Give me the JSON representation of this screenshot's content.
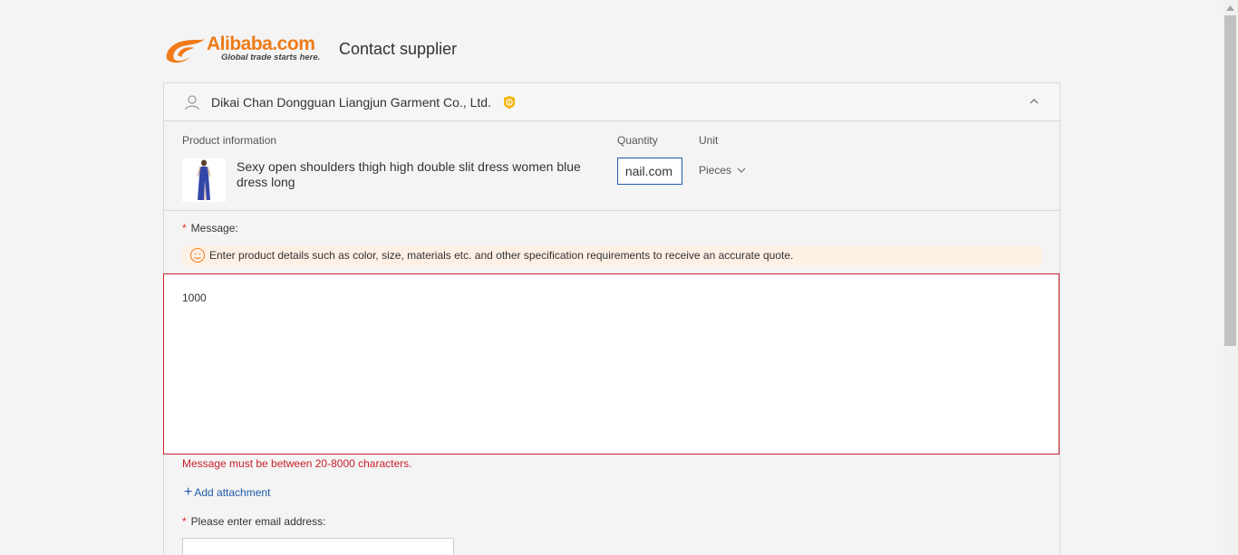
{
  "header": {
    "logo_text": "Alibaba.com",
    "logo_tagline": "Global trade starts here.",
    "title": "Contact supplier"
  },
  "supplier": {
    "name": "Dikai Chan Dongguan Liangjun Garment Co., Ltd.",
    "icon": "user-icon",
    "badge_icon": "gold-supplier-icon"
  },
  "product": {
    "section_label": "Product information",
    "quantity_label": "Quantity",
    "unit_label": "Unit",
    "name": "Sexy open shoulders thigh high double slit dress women blue dress long",
    "quantity_value": "nail.com",
    "unit_value": "Pieces"
  },
  "message": {
    "required_mark": "*",
    "label": "Message:",
    "tip": "Enter product details such as color, size, materials etc. and other specification requirements to receive an accurate quote.",
    "value": "1000",
    "error": "Message must be between 20-8000 characters."
  },
  "attachment": {
    "plus": "+",
    "label": "Add attachment"
  },
  "email": {
    "required_mark": "*",
    "label": "Please enter email address:",
    "value": ""
  },
  "colors": {
    "brand_orange": "#f07b19",
    "error_red": "#c8202a",
    "link_blue": "#1f5aa8",
    "tip_bg": "#fdf0e4"
  }
}
